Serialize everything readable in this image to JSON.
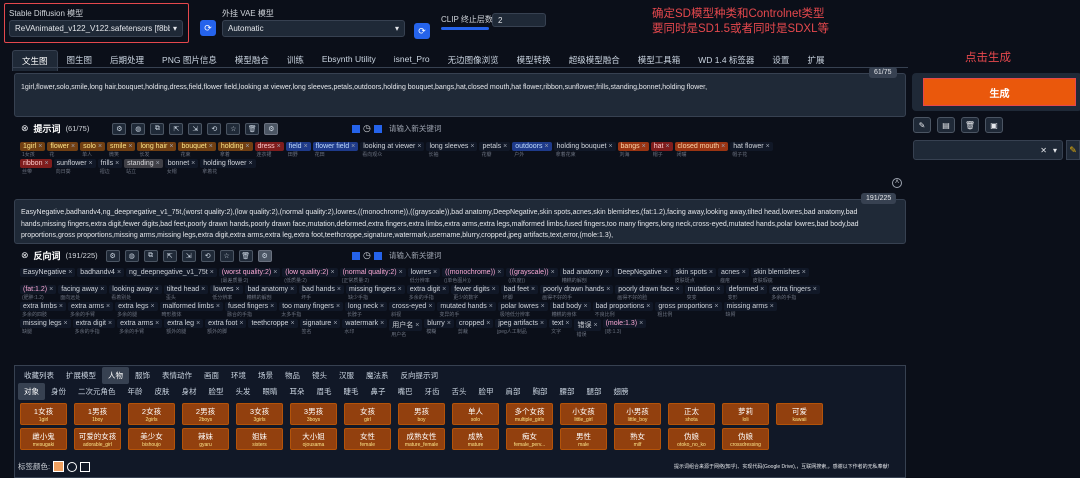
{
  "top": {
    "model_label": "Stable Diffusion 模型",
    "model_value": "ReVAnimated_v122_V122.safetensors [f8bb2922]",
    "vae_label": "外挂 VAE 模型",
    "vae_value": "Automatic",
    "clip_label": "CLIP 终止层数",
    "clip_value": "2"
  },
  "annotation": {
    "line1": "确定SD模型种类和Controlnet类型",
    "line2": "要同时是SD1.5或者同时是SDXL等",
    "gen": "点击生成"
  },
  "tabs": [
    "文生图",
    "图生图",
    "后期处理",
    "PNG 图片信息",
    "模型融合",
    "训练",
    "Ebsynth Utility",
    "isnet_Pro",
    "无边图像浏览",
    "模型转换",
    "超级模型融合",
    "模型工具箱",
    "WD 1.4 标签器",
    "设置",
    "扩展"
  ],
  "prompt": {
    "counter": "61/75",
    "text": "1girl,flower,solo,smile,long hair,bouquet,holding,dress,field,flower field,looking at viewer,long sleeves,petals,outdoors,holding bouquet,bangs,hat,closed mouth,hat flower,ribbon,sunflower,frills,standing,bonnet,holding flower,",
    "title": "提示词",
    "count": "(61/75)",
    "placeholder": "请输入新关键词"
  },
  "prompt_tags": [
    [
      [
        "1girl",
        "1女孩",
        "ol"
      ],
      [
        "flower",
        "花",
        "ol"
      ],
      [
        "solo",
        "单人",
        "ol"
      ],
      [
        "smile",
        "微笑",
        "ol"
      ],
      [
        "long hair",
        "长发",
        "ol"
      ],
      [
        "bouquet",
        "花束",
        "ol"
      ],
      [
        "holding",
        "拿着",
        "ol"
      ],
      [
        "dress",
        "连衣裙",
        "red"
      ],
      [
        "field",
        "田野",
        "bl"
      ],
      [
        "flower field",
        "花田",
        "bl"
      ],
      [
        "looking at viewer",
        "看向观众",
        ""
      ],
      [
        "long sleeves",
        "长袖",
        ""
      ],
      [
        "petals",
        "花瓣",
        ""
      ],
      [
        "outdoors",
        "户外",
        "bl"
      ],
      [
        "holding bouquet",
        "拿着花束",
        ""
      ],
      [
        "bangs",
        "刘海",
        "or"
      ],
      [
        "hat",
        "帽子",
        "red"
      ],
      [
        "closed mouth",
        "闭嘴",
        "or"
      ],
      [
        "hat flower",
        "帽子花",
        ""
      ]
    ],
    [
      [
        "ribbon",
        "丝带",
        "red"
      ],
      [
        "sunflower",
        "向日葵",
        ""
      ],
      [
        "frills",
        "褶边",
        ""
      ],
      [
        "standing",
        "站立",
        "gr"
      ],
      [
        "bonnet",
        "女帽",
        ""
      ],
      [
        "holding flower",
        "拿着花",
        ""
      ]
    ]
  ],
  "neg": {
    "counter": "191/225",
    "text": "EasyNegative,badhandv4,ng_deepnegative_v1_75t,(worst quality:2),(low quality:2),(normal quality:2),lowres,((monochrome)),((grayscale)),bad anatomy,DeepNegative,skin spots,acnes,skin blemishes,(fat:1.2),facing away,looking away,tilted head,lowres,bad anatomy,bad hands,missing fingers,extra digit,fewer digits,bad feet,poorly drawn hands,poorly drawn face,mutation,deformed,extra fingers,extra limbs,extra arms,extra legs,malformed limbs,fused fingers,too many fingers,long neck,cross-eyed,mutated hands,polar lowres,bad body,bad proportions,gross proportions,missing arms,missing legs,extra digit,extra arms,extra leg,extra foot,teethcroppe,signature,watermark,username,blurry,cropped,jpeg artifacts,text,error,(mole:1.3),",
    "title": "反向词",
    "count": "(191/225)",
    "placeholder": "请输入新关键词"
  },
  "neg_tags": [
    [
      [
        "EasyNegative",
        ""
      ],
      [
        "badhandv4",
        ""
      ],
      [
        "ng_deepnegative_v1_75t",
        ""
      ],
      [
        "(worst quality:2)",
        "(最差质量:2)"
      ],
      [
        "(low quality:2)",
        "(低质量:2)"
      ],
      [
        "(normal quality:2)",
        "(正常质量:2)"
      ],
      [
        "lowres",
        "低分辨率"
      ],
      [
        "((monochrome))",
        "((单色图片))"
      ],
      [
        "((grayscale))",
        "((灰度))"
      ],
      [
        "bad anatomy",
        "糟糕的解剖"
      ],
      [
        "DeepNegative",
        ""
      ],
      [
        "skin spots",
        "皮肤斑点"
      ],
      [
        "acnes",
        "痤疮"
      ],
      [
        "skin blemishes",
        "皮肤瑕疵"
      ]
    ],
    [
      [
        "(fat:1.2)",
        "(肥胖:1.2)"
      ],
      [
        "facing away",
        "面向远处"
      ],
      [
        "looking away",
        "看着别处"
      ],
      [
        "tilted head",
        "歪头"
      ],
      [
        "lowres",
        "低分辨率"
      ],
      [
        "bad anatomy",
        "糟糕的解剖"
      ],
      [
        "bad hands",
        "坏手"
      ],
      [
        "missing fingers",
        "缺少手指"
      ],
      [
        "extra digit",
        "多余的手指"
      ],
      [
        "fewer digits",
        "更少的数字"
      ],
      [
        "bad feet",
        "坏脚"
      ],
      [
        "poorly drawn hands",
        "画得不好的手"
      ],
      [
        "poorly drawn face",
        "画得不好的脸"
      ],
      [
        "mutation",
        "突变"
      ],
      [
        "deformed",
        "变形"
      ],
      [
        "extra fingers",
        "多余的手指"
      ]
    ],
    [
      [
        "extra limbs",
        "多余的四肢"
      ],
      [
        "extra arms",
        "多余的手臂"
      ],
      [
        "extra legs",
        "多余的腿"
      ],
      [
        "malformed limbs",
        "畸形肢体"
      ],
      [
        "fused fingers",
        "融合的手指"
      ],
      [
        "too many fingers",
        "太多手指"
      ],
      [
        "long neck",
        "长脖子"
      ],
      [
        "cross-eyed",
        "斜视"
      ],
      [
        "mutated hands",
        "变异的手"
      ],
      [
        "polar lowres",
        "极地低分辨率"
      ],
      [
        "bad body",
        "糟糕的身体"
      ],
      [
        "bad proportions",
        "不良比例"
      ],
      [
        "gross proportions",
        "粗比例"
      ],
      [
        "missing arms",
        "缺臂"
      ]
    ],
    [
      [
        "missing legs",
        "缺腿"
      ],
      [
        "extra digit",
        "多余的手指"
      ],
      [
        "extra arms",
        "多余的手臂"
      ],
      [
        "extra leg",
        "额外的腿"
      ],
      [
        "extra foot",
        "额外的脚"
      ],
      [
        "teethcroppe",
        ""
      ],
      [
        "signature",
        "签名"
      ],
      [
        "watermark",
        "水印"
      ],
      [
        "用户名",
        "用户名"
      ],
      [
        "blurry",
        "模糊"
      ],
      [
        "cropped",
        "剪裁"
      ],
      [
        "jpeg artifacts",
        "jpeg人工制品"
      ],
      [
        "text",
        "文字"
      ],
      [
        "错误",
        "错误"
      ],
      [
        "(mole:1.3)",
        "(痣:1.3)"
      ]
    ]
  ],
  "cat1": [
    "收藏列表",
    "扩展模型",
    "人物",
    "服饰",
    "表情动作",
    "画面",
    "环境",
    "场景",
    "物品",
    "镜头",
    "汉服",
    "魔法系",
    "反向提示词"
  ],
  "cat2": [
    "对象",
    "身份",
    "二次元角色",
    "年龄",
    "皮肤",
    "身材",
    "脸型",
    "头发",
    "眼睛",
    "耳朵",
    "眉毛",
    "睫毛",
    "鼻子",
    "嘴巴",
    "牙齿",
    "舌头",
    "脸甲",
    "肩部",
    "胸部",
    "腰部",
    "腿部",
    "翅膀"
  ],
  "presets": [
    [
      [
        "1女孩",
        "1girl"
      ],
      [
        "1男孩",
        "1boy"
      ],
      [
        "2女孩",
        "2girls"
      ],
      [
        "2男孩",
        "2boys"
      ],
      [
        "3女孩",
        "3girls"
      ],
      [
        "3男孩",
        "3boys"
      ],
      [
        "女孩",
        "girl"
      ],
      [
        "男孩",
        "boy"
      ],
      [
        "单人",
        "solo"
      ],
      [
        "多个女孩",
        "multiple_girls"
      ],
      [
        "小女孩",
        "little_girl"
      ],
      [
        "小男孩",
        "little_boy"
      ],
      [
        "正太",
        "shota"
      ],
      [
        "萝莉",
        "loli"
      ],
      [
        "可爱",
        "kawaii"
      ]
    ],
    [
      [
        "雌小鬼",
        "mesugaki"
      ],
      [
        "可爱的女孩",
        "adorable_girl"
      ],
      [
        "美少女",
        "bishoujo"
      ],
      [
        "辣妹",
        "gyaru"
      ],
      [
        "姐妹",
        "sisters"
      ],
      [
        "大小姐",
        "ojousama"
      ],
      [
        "女性",
        "female"
      ],
      [
        "成熟女性",
        "mature_female"
      ],
      [
        "成熟",
        "mature"
      ],
      [
        "痴女",
        "female_perv..."
      ],
      [
        "男性",
        "male"
      ],
      [
        "熟女",
        "milf"
      ],
      [
        "伪娘",
        "otoko_no_ko"
      ],
      [
        "伪娘",
        "crossdressing"
      ]
    ]
  ],
  "footer": {
    "label": "标签颜色:",
    "note": "提示词组合来源于网络(知乎)、实现代码(Google Drive),，互联网搜索,，感谢以下作者的无私奉献!"
  },
  "generate": "生成"
}
